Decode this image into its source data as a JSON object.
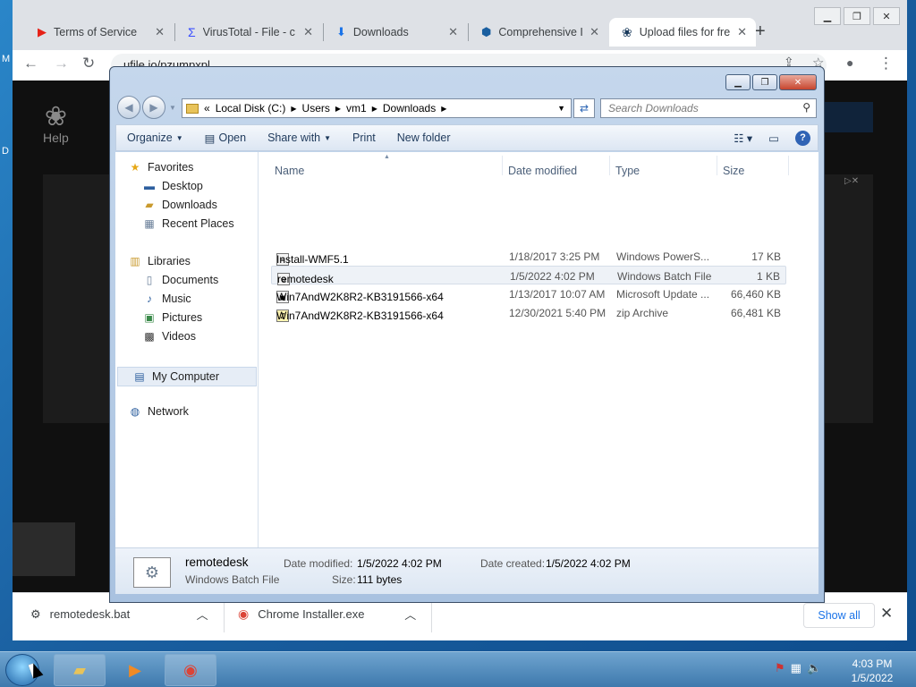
{
  "browser": {
    "tabs": [
      {
        "title": "Terms of Service",
        "icon": "youtube-icon"
      },
      {
        "title": "VirusTotal - File - c",
        "icon": "virustotal-icon"
      },
      {
        "title": "Downloads",
        "icon": "download-icon"
      },
      {
        "title": "Comprehensive IP",
        "icon": "location-icon"
      },
      {
        "title": "Upload files for fre",
        "icon": "ufile-icon",
        "active": true
      }
    ],
    "url": "ufile.io/pzumpxpl",
    "page": {
      "help_label": "Help"
    },
    "downloads_shelf": {
      "items": [
        {
          "name": "remotedesk.bat"
        },
        {
          "name": "Chrome Installer.exe"
        }
      ],
      "show_all": "Show all"
    }
  },
  "explorer": {
    "breadcrumb": [
      "«",
      "Local Disk (C:)",
      "Users",
      "vm1",
      "Downloads"
    ],
    "search_placeholder": "Search Downloads",
    "commands": [
      "Organize",
      "Open",
      "Share with",
      "Print",
      "New folder"
    ],
    "nav": {
      "favorites": "Favorites",
      "favorites_items": [
        "Desktop",
        "Downloads",
        "Recent Places"
      ],
      "libraries": "Libraries",
      "libraries_items": [
        "Documents",
        "Music",
        "Pictures",
        "Videos"
      ],
      "computer": "My Computer",
      "network": "Network"
    },
    "columns": [
      "Name",
      "Date modified",
      "Type",
      "Size"
    ],
    "files": [
      {
        "name": "Install-WMF5.1",
        "date": "1/18/2017 3:25 PM",
        "type": "Windows PowerS...",
        "size": "17 KB"
      },
      {
        "name": "remotedesk",
        "date": "1/5/2022 4:02 PM",
        "type": "Windows Batch File",
        "size": "1 KB"
      },
      {
        "name": "Win7AndW2K8R2-KB3191566-x64",
        "date": "1/13/2017 10:07 AM",
        "type": "Microsoft Update ...",
        "size": "66,460 KB"
      },
      {
        "name": "Win7AndW2K8R2-KB3191566-x64",
        "date": "12/30/2021 5:40 PM",
        "type": "zip Archive",
        "size": "66,481 KB"
      }
    ],
    "details": {
      "name": "remotedesk",
      "type": "Windows Batch File",
      "date_modified_label": "Date modified:",
      "date_modified": "1/5/2022 4:02 PM",
      "date_created_label": "Date created:",
      "date_created": "1/5/2022 4:02 PM",
      "size_label": "Size:",
      "size": "111 bytes"
    }
  },
  "taskbar": {
    "time": "4:03 PM",
    "date": "1/5/2022"
  }
}
